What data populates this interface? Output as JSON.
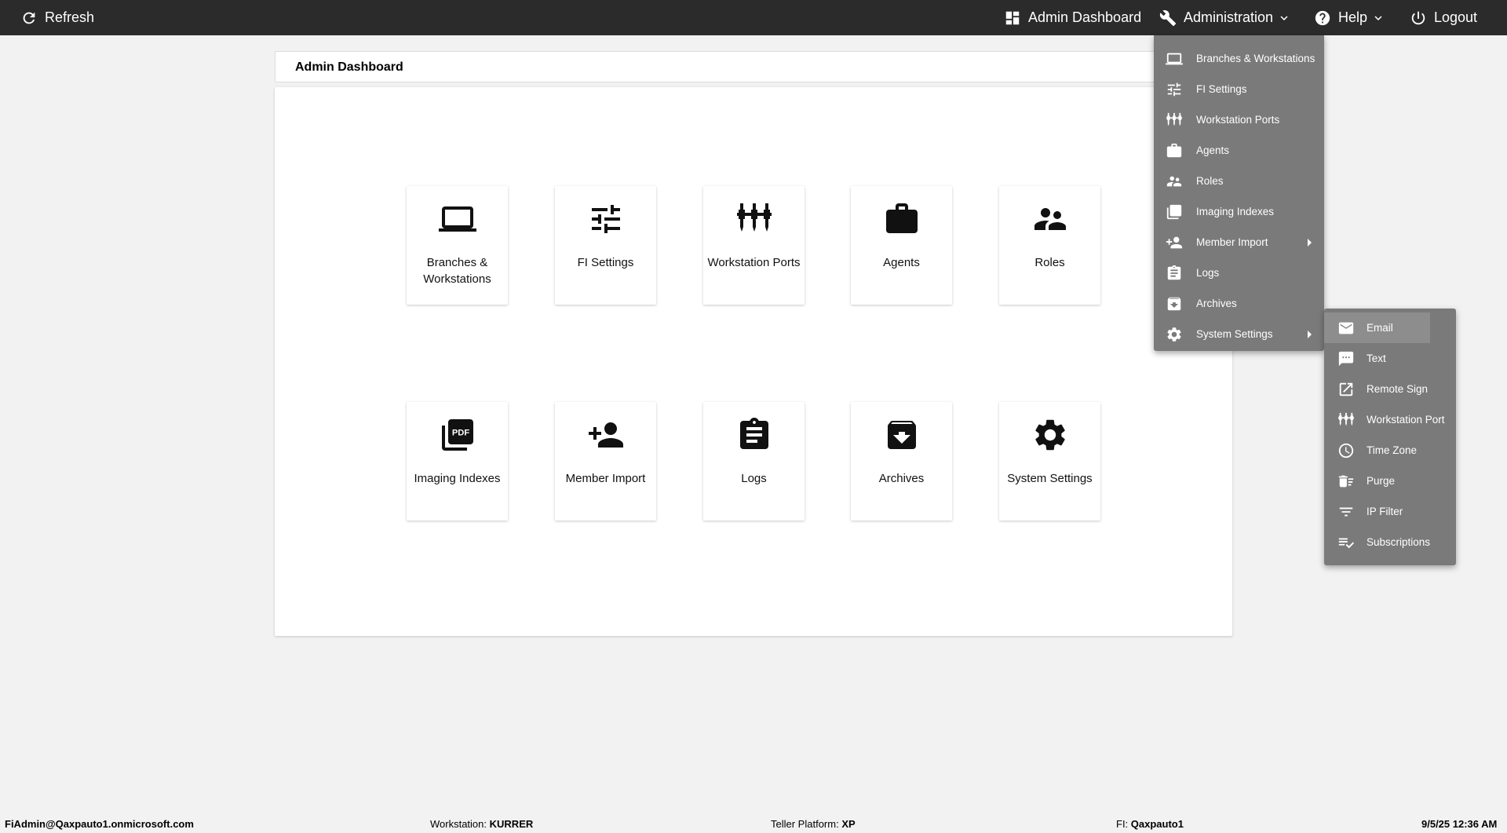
{
  "topbar": {
    "refresh": "Refresh",
    "admin_dashboard": "Admin Dashboard",
    "administration": "Administration",
    "help": "Help",
    "logout": "Logout"
  },
  "page_title": "Admin Dashboard",
  "tiles": [
    {
      "label": "Branches & Workstations",
      "icon": "laptop-icon"
    },
    {
      "label": "FI Settings",
      "icon": "tune-icon"
    },
    {
      "label": "Workstation Ports",
      "icon": "ports-icon"
    },
    {
      "label": "Agents",
      "icon": "briefcase-icon"
    },
    {
      "label": "Roles",
      "icon": "people-icon"
    },
    {
      "label": "Imaging Indexes",
      "icon": "pdf-icon"
    },
    {
      "label": "Member Import",
      "icon": "person-add-icon"
    },
    {
      "label": "Logs",
      "icon": "clipboard-icon"
    },
    {
      "label": "Archives",
      "icon": "archive-icon"
    },
    {
      "label": "System Settings",
      "icon": "gear-icon"
    }
  ],
  "admin_menu": [
    {
      "label": "Branches & Workstations",
      "icon": "laptop-icon"
    },
    {
      "label": "FI Settings",
      "icon": "tune-icon"
    },
    {
      "label": "Workstation Ports",
      "icon": "ports-icon"
    },
    {
      "label": "Agents",
      "icon": "briefcase-icon"
    },
    {
      "label": "Roles",
      "icon": "people-icon"
    },
    {
      "label": "Imaging Indexes",
      "icon": "pdf-icon"
    },
    {
      "label": "Member Import",
      "icon": "person-add-icon",
      "submenu": true
    },
    {
      "label": "Logs",
      "icon": "clipboard-icon"
    },
    {
      "label": "Archives",
      "icon": "archive-icon"
    },
    {
      "label": "System Settings",
      "icon": "gear-icon",
      "submenu": true
    }
  ],
  "system_settings_menu": [
    {
      "label": "Email",
      "icon": "email-icon"
    },
    {
      "label": "Text",
      "icon": "sms-icon"
    },
    {
      "label": "Remote Sign",
      "icon": "open-external-icon"
    },
    {
      "label": "Workstation Port",
      "icon": "ports-icon"
    },
    {
      "label": "Time Zone",
      "icon": "clock-icon"
    },
    {
      "label": "Purge",
      "icon": "delete-sweep-icon"
    },
    {
      "label": "IP Filter",
      "icon": "filter-icon"
    },
    {
      "label": "Subscriptions",
      "icon": "playlist-check-icon"
    }
  ],
  "statusbar": {
    "user": "FiAdmin@Qaxpauto1.onmicrosoft.com",
    "workstation_label": "Workstation:",
    "workstation_value": "KURRER",
    "platform_label": "Teller Platform:",
    "platform_value": "XP",
    "fi_label": "FI:",
    "fi_value": "Qaxpauto1",
    "datetime": "9/5/25 12:36 AM"
  },
  "colors": {
    "topbar": "#2b2b2b",
    "menu": "#7a7a7a",
    "menu_highlight": "#8d8d8d",
    "background": "#f2f2f2"
  }
}
